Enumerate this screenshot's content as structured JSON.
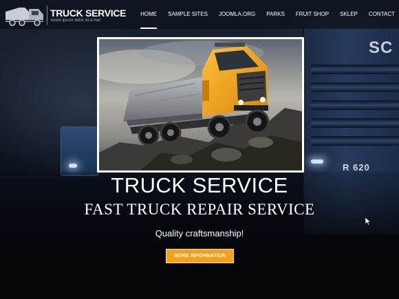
{
  "header": {
    "logo_title": "TRUCK SERVICE",
    "logo_tagline": "lorem ipsum dolor sit a met"
  },
  "nav": {
    "items": [
      {
        "label": "HOME",
        "active": true
      },
      {
        "label": "SAMPLE SITES",
        "active": false
      },
      {
        "label": "JOOMLA.ORG",
        "active": false
      },
      {
        "label": "PARKS",
        "active": false
      },
      {
        "label": "FRUIT SHOP",
        "active": false
      },
      {
        "label": "SKLEP",
        "active": false
      },
      {
        "label": "CONTACT",
        "active": false
      }
    ]
  },
  "background": {
    "truck_brand": "SC",
    "truck_model": "R 620"
  },
  "hero": {
    "title": "TRUCK SERVICE",
    "subtitle": "FAST TRUCK REPAIR SERVICE",
    "tagline": "Quality craftsmanship!",
    "cta_label": "MORE INFORMATION"
  },
  "colors": {
    "accent": "#f5a11a",
    "truck_body": "#f2a417"
  }
}
